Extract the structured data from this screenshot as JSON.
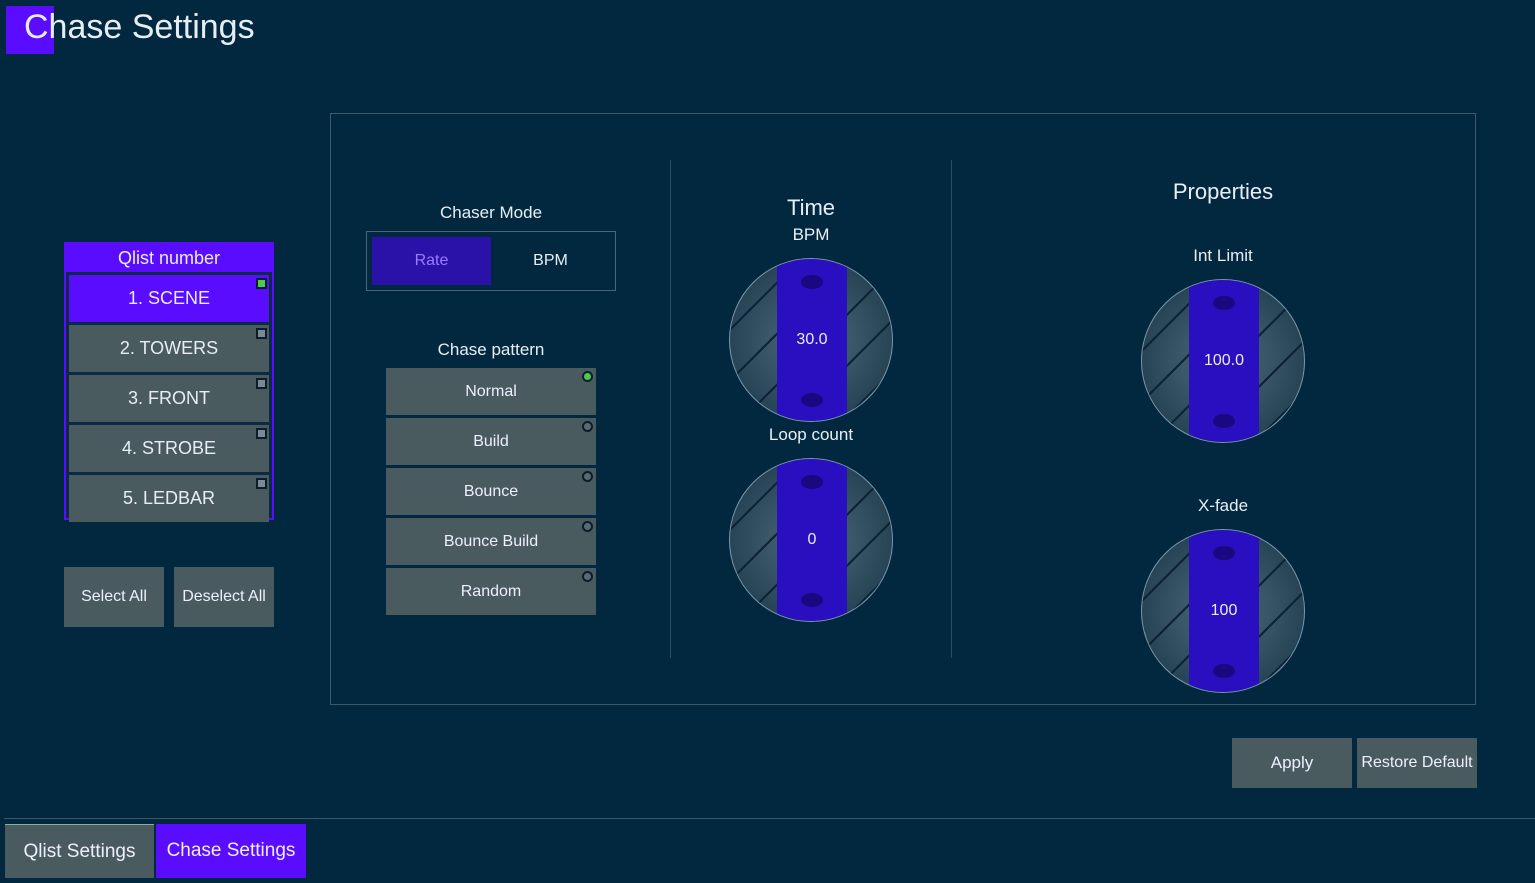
{
  "header": {
    "title": "Chase Settings"
  },
  "qlist": {
    "header": "Qlist number",
    "items": [
      {
        "label": "1. SCENE",
        "selected": true
      },
      {
        "label": "2. TOWERS",
        "selected": false
      },
      {
        "label": "3. FRONT",
        "selected": false
      },
      {
        "label": "4. STROBE",
        "selected": false
      },
      {
        "label": "5. LEDBAR",
        "selected": false
      }
    ],
    "select_all": "Select All",
    "deselect_all": "Deselect All"
  },
  "chaser_mode": {
    "label": "Chaser Mode",
    "options": [
      "Rate",
      "BPM"
    ],
    "selected": "Rate"
  },
  "chase_pattern": {
    "label": "Chase pattern",
    "options": [
      "Normal",
      "Build",
      "Bounce",
      "Bounce Build",
      "Random"
    ],
    "selected": "Normal"
  },
  "time": {
    "label": "Time",
    "sublabel": "BPM",
    "value": "30.0",
    "loop_label": "Loop count",
    "loop_value": "0"
  },
  "properties": {
    "label": "Properties",
    "int_limit_label": "Int Limit",
    "int_limit_value": "100.0",
    "xfade_label": "X-fade",
    "xfade_value": "100"
  },
  "actions": {
    "apply": "Apply",
    "restore": "Restore Default"
  },
  "tabs": [
    {
      "label": "Qlist Settings",
      "active": false
    },
    {
      "label": "Chase Settings",
      "active": true
    }
  ],
  "colors": {
    "accent": "#5a0cff",
    "background": "#022840",
    "button": "#4a5b60",
    "knob_strip": "#2a0fc0",
    "indicator_on": "#4ccc4c"
  }
}
